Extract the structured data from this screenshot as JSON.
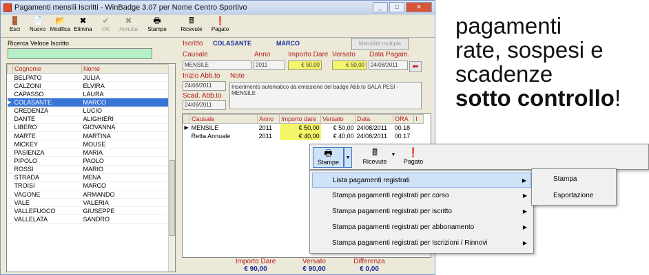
{
  "window": {
    "title": "Pagamenti mensili Iscritti - WinBadge 3.07 per Nome Centro Sportivo",
    "min_label": "_",
    "max_label": "□",
    "close_label": "✕"
  },
  "toolbar": {
    "buttons": [
      {
        "label": "Esci",
        "icon": "🚪"
      },
      {
        "label": "Nuovo",
        "icon": "📄"
      },
      {
        "label": "Modifica",
        "icon": "📂"
      },
      {
        "label": "Elimina",
        "icon": "✖"
      },
      {
        "label": "OK",
        "icon": "✔"
      },
      {
        "label": "Annulla",
        "icon": "✖"
      },
      {
        "label": "Stampe",
        "icon": "🖶"
      },
      {
        "label": "Ricevute",
        "icon": "🖩"
      },
      {
        "label": "Pagato",
        "icon": "❗"
      }
    ]
  },
  "search": {
    "label": "Ricerca Veloce Iscritto",
    "value": ""
  },
  "members": {
    "headers": [
      "Cognome",
      "Nome"
    ],
    "rows": [
      [
        "BELPATO",
        "JULIA"
      ],
      [
        "CALZONI",
        "ELVIRA"
      ],
      [
        "CAPASSO",
        "LAURA"
      ],
      [
        "COLASANTE",
        "MARCO"
      ],
      [
        "CREDENZA",
        "LUCIO"
      ],
      [
        "DANTE",
        "ALIGHIERI"
      ],
      [
        "LIBERO",
        "GIOVANNA"
      ],
      [
        "MARTE",
        "MARTINA"
      ],
      [
        "MICKEY",
        "MOUSE"
      ],
      [
        "PASIENZA",
        "MARIA"
      ],
      [
        "PIPOLO",
        "PAOLO"
      ],
      [
        "ROSSI",
        "MARIO"
      ],
      [
        "STRADA",
        "MENA"
      ],
      [
        "TROISI",
        "MARCO"
      ],
      [
        "VAGONE",
        "ARMANDO"
      ],
      [
        "VALE",
        "VALERIA"
      ],
      [
        "VALLEFUOCO",
        "GIUSEPPE"
      ],
      [
        "VALLELATA",
        "SANDRO"
      ]
    ],
    "selected_index": 3
  },
  "detail": {
    "iscritto_label": "Iscritto",
    "cognome": "COLASANTE",
    "nome": "MARCO",
    "mensilita_button": "Mensilità multiple",
    "causale_label": "Causale",
    "anno_label": "Anno",
    "importo_label": "Importo Dare",
    "versato_label": "Versato",
    "data_label": "Data Pagam.",
    "causale": "MENSILE",
    "anno": "2011",
    "importo": "€ 50,00",
    "versato": "€ 50,00",
    "data": "24/08/2011",
    "inizio_label": "Inizio Abb.to",
    "inizio": "24/08/2011",
    "scad_label": "Scad. Abb.to",
    "scad": "24/09/2011",
    "note_label": "Note",
    "note": "Inserimento automatico da emissione del badge Abb.to SALA PESI - MENSILE"
  },
  "payments": {
    "headers": [
      "Causale",
      "Anno",
      "Importo dare",
      "Versato",
      "Data",
      "ORA",
      "I"
    ],
    "rows": [
      [
        "MENSILE",
        "2011",
        "€ 50,00",
        "€ 50,00",
        "24/08/2011",
        "00.18"
      ],
      [
        "Retta Annuale",
        "2011",
        "€ 40,00",
        "€ 40,00",
        "24/08/2011",
        "00.17"
      ]
    ]
  },
  "totals": {
    "importo_label": "Importo Dare",
    "importo": "€ 90,00",
    "versato_label": "Versato",
    "versato": "€ 90,00",
    "differenza_label": "Differenza",
    "differenza": "€ 0,00"
  },
  "popup_toolbar": {
    "stampe": "Stampe",
    "ricevute": "Ricevute",
    "pagato": "Pagato"
  },
  "menu": {
    "items": [
      "Lista pagamenti registrati",
      "Stampa pagamenti registrati per corso",
      "Stampa pagamenti registrati per iscritto",
      "Stampa pagamenti registrati per abbonamento",
      "Stampa pagamenti registrati per Iscrizioni / Rinnovi"
    ],
    "highlighted_index": 0,
    "submenu": [
      "Stampa",
      "Esportazione"
    ]
  },
  "tagline": {
    "line1": "pagamenti",
    "line2": "rate, sospesi e",
    "line3": "scadenze",
    "bold": "sotto controllo",
    "end": "!"
  },
  "colors": {
    "accent": "#3875d7",
    "label_red": "#b41e1e",
    "value_blue": "#1a2ea0",
    "highlight_yellow": "#f5f56a",
    "search_green": "#b7f0c6"
  }
}
